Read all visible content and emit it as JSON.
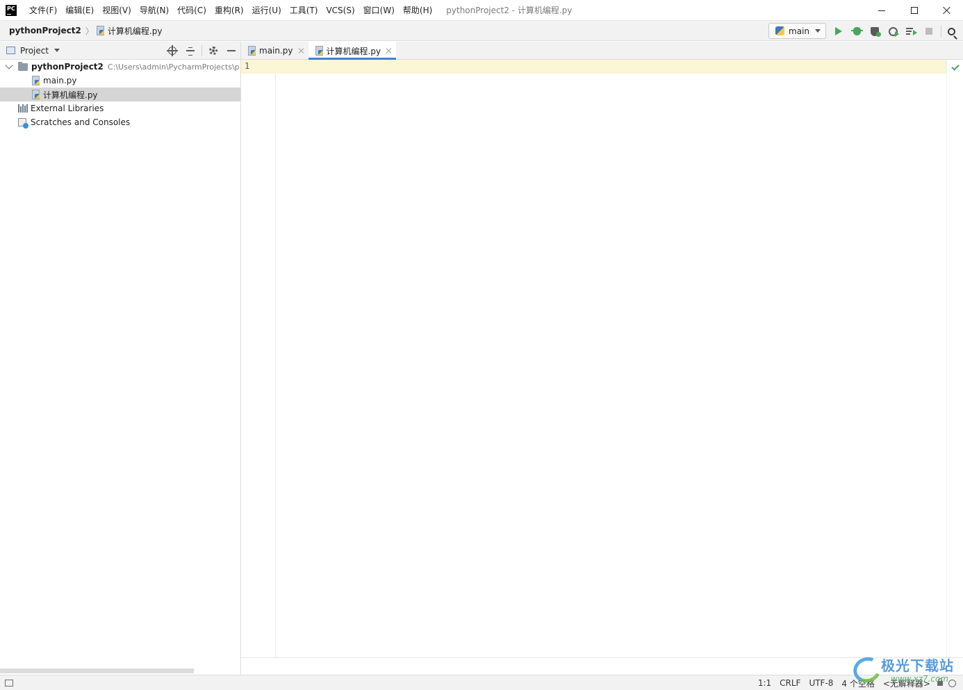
{
  "titlebar": {
    "logo_text": "PC",
    "menu": [
      "文件(F)",
      "编辑(E)",
      "视图(V)",
      "导航(N)",
      "代码(C)",
      "重构(R)",
      "运行(U)",
      "工具(T)",
      "VCS(S)",
      "窗口(W)",
      "帮助(H)"
    ],
    "window_title": "pythonProject2 - 计算机编程.py"
  },
  "navbar": {
    "project": "pythonProject2",
    "file": "计算机编程.py",
    "run_config": "main"
  },
  "project_panel": {
    "title": "Project",
    "tree": {
      "root_label": "pythonProject2",
      "root_path": "C:\\Users\\admin\\PycharmProjects\\p",
      "file1": "main.py",
      "file2": "计算机编程.py",
      "libraries": "External Libraries",
      "scratches": "Scratches and Consoles"
    }
  },
  "editor": {
    "tabs": [
      "main.py",
      "计算机编程.py"
    ],
    "active_tab": 1,
    "line_number": "1",
    "content": ""
  },
  "statusbar": {
    "position": "1:1",
    "line_sep": "CRLF",
    "encoding": "UTF-8",
    "indent": "4 个空格",
    "interpreter": "<无解释器>"
  },
  "watermark": {
    "title": "极光下载站",
    "url": "www.xz7.com"
  },
  "colors": {
    "accent": "#4083c9",
    "current_line": "#fcf5d6",
    "run_green": "#4aa45a",
    "selection": "#d5d5d5"
  }
}
